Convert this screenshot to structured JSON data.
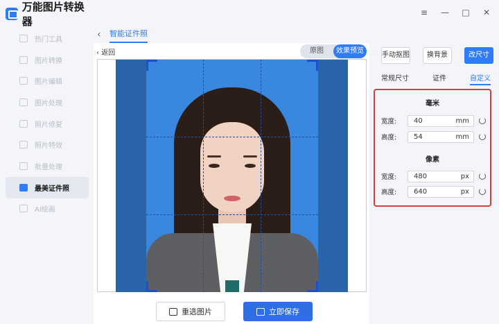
{
  "app": {
    "name": "万能图片转换器"
  },
  "sidebar": {
    "items": [
      {
        "label": "热门工具",
        "active": false
      },
      {
        "label": "图片转换",
        "active": false
      },
      {
        "label": "图片编辑",
        "active": false
      },
      {
        "label": "图片处理",
        "active": false
      },
      {
        "label": "照片修复",
        "active": false
      },
      {
        "label": "照片特效",
        "active": false
      },
      {
        "label": "批量处理",
        "active": false
      },
      {
        "label": "最美证件照",
        "active": true
      },
      {
        "label": "AI绘画",
        "active": false
      }
    ]
  },
  "window_controls": {
    "menu": "≡",
    "minimize": "—",
    "maximize": "□",
    "close": "✕"
  },
  "header": {
    "back": "‹",
    "tab": "智能证件照"
  },
  "preview": {
    "back_label": "返回",
    "toggle": {
      "original": "原图",
      "effect": "效果预览"
    },
    "reselect_button": "重选图片",
    "save_button": "立即保存"
  },
  "right_panel": {
    "buttons": {
      "cutout": "手动抠图",
      "change_bg": "换背景",
      "resize": "改尺寸"
    },
    "tabs": [
      "常规尺寸",
      "证件",
      "自定义"
    ],
    "active_tab": "自定义",
    "mm_section": {
      "title": "毫米",
      "width_label": "宽度:",
      "width_value": "40",
      "width_unit": "mm",
      "height_label": "高度:",
      "height_value": "54",
      "height_unit": "mm"
    },
    "px_section": {
      "title": "像素",
      "width_label": "宽度:",
      "width_value": "480",
      "width_unit": "px",
      "height_label": "高度:",
      "height_value": "640",
      "height_unit": "px"
    }
  },
  "colors": {
    "accent": "#2f7cf6",
    "highlight_border": "#d93c3c",
    "photo_bg": "#3a87e0"
  }
}
